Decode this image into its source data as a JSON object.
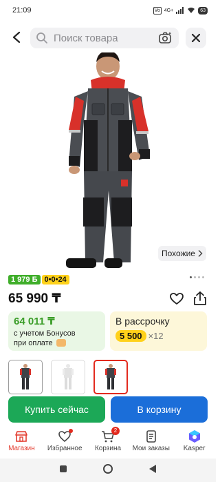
{
  "status_bar": {
    "time": "21:09",
    "network": "4G+",
    "sim": "Vo",
    "battery": "63"
  },
  "search": {
    "placeholder": "Поиск товара"
  },
  "product": {
    "similar_label": "Похожие",
    "gallery": {
      "count": 4,
      "active_index": 0
    },
    "badge_bonus": "1 979 Б",
    "badge_installment": "0•0•24",
    "price": "65 990 ₸"
  },
  "bonus_card": {
    "price": "64 011 ₸",
    "text_line1": "с учетом Бонусов",
    "text_line2": "при оплате"
  },
  "installment_card": {
    "title": "В рассрочку",
    "amount": "5 500",
    "multiplier": "×12"
  },
  "variants": [
    {
      "name": "dark-red"
    },
    {
      "name": "light-gray"
    },
    {
      "name": "dark-red-selected"
    }
  ],
  "actions": {
    "buy_now": "Купить сейчас",
    "add_to_cart": "В корзину"
  },
  "nav": [
    {
      "label": "Магазин",
      "icon": "shop-icon",
      "active": true
    },
    {
      "label": "Избранное",
      "icon": "heart-icon"
    },
    {
      "label": "Корзина",
      "icon": "cart-icon",
      "count": "2"
    },
    {
      "label": "Мои заказы",
      "icon": "orders-icon"
    },
    {
      "label": "Kasper",
      "icon": "kasper-icon"
    }
  ],
  "colors": {
    "accent_red": "#e32a1e",
    "green": "#1ca857",
    "blue": "#1b6ed9",
    "yellow": "#ffd11a"
  }
}
